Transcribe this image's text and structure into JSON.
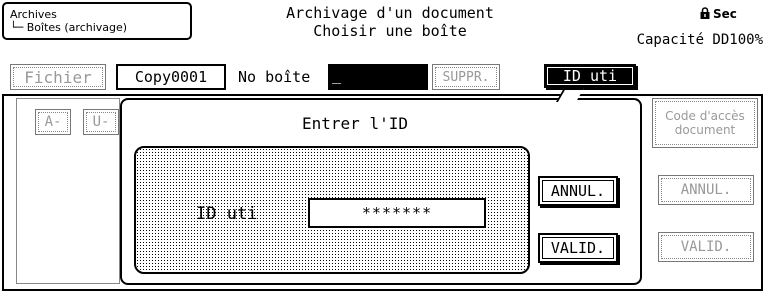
{
  "breadcrumb": {
    "line1": "Archives",
    "line2": "└─ Boîtes (archivage)"
  },
  "header": {
    "title_line1": "Archivage d'un document",
    "title_line2": "Choisir une boîte",
    "secure_label": "Sec",
    "capacity": "Capacité DD100%"
  },
  "toolbar": {
    "file_button": "Fichier",
    "file_name": "Copy0001",
    "box_label": "No boîte",
    "box_value": "_",
    "delete_button": "SUPPR.",
    "user_id_button": "ID uti"
  },
  "left_panel": {
    "tab_a": "A-",
    "tab_u": "U-"
  },
  "dialog": {
    "title": "Entrer l'ID",
    "field_label": "ID uti",
    "field_value": "*******",
    "cancel_button": "ANNUL.",
    "confirm_button": "VALID."
  },
  "right_panel": {
    "access_code_button": "Code d'accès document",
    "cancel_button": "ANNUL.",
    "confirm_button": "VALID."
  }
}
